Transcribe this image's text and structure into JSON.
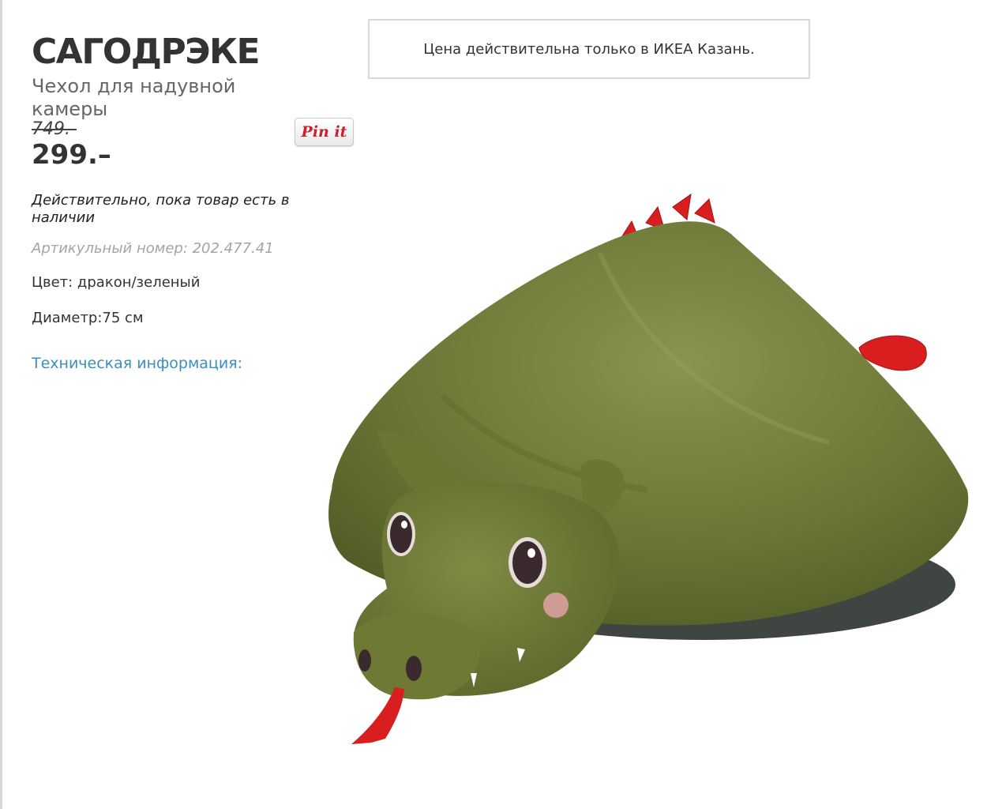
{
  "product": {
    "name": "САГОДРЭКЕ",
    "subtitle": "Чехол для надувной камеры",
    "old_price": "749.-",
    "price": "299.–",
    "validity": "Действительно, пока товар есть в наличии",
    "article_label": "Артикульный номер: 202.477.41",
    "color": "Цвет: дракон/зеленый",
    "diameter": "Диаметр:75 см",
    "tech_info_link": "Техническая информация:"
  },
  "notice": {
    "text": "Цена действительна только в ИКЕА Казань."
  },
  "pinit_button": {
    "label": "Pin it"
  },
  "colors": {
    "title": "#333333",
    "link": "#3a8fc0",
    "muted": "#a4a4a4",
    "pinit": "#c8232c",
    "dragon_green": "#6f7a3a",
    "dragon_red": "#d81e1e"
  },
  "image": {
    "icon": "dragon-beanbag-cover-image"
  }
}
